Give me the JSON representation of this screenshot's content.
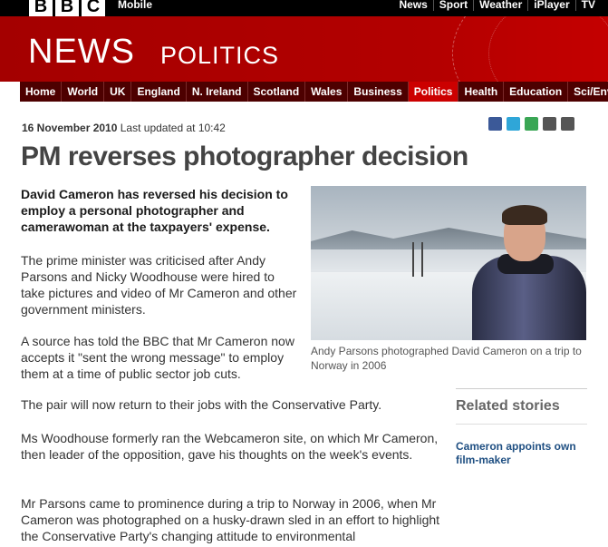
{
  "topbar": {
    "logo_letters": [
      "B",
      "B",
      "C"
    ],
    "mobile": "Mobile",
    "links": [
      "News",
      "Sport",
      "Weather",
      "iPlayer",
      "TV"
    ]
  },
  "banner": {
    "news": "NEWS",
    "section": "POLITICS"
  },
  "nav": {
    "items": [
      "Home",
      "World",
      "UK",
      "England",
      "N. Ireland",
      "Scotland",
      "Wales",
      "Business",
      "Politics",
      "Health",
      "Education",
      "Sci/Environment"
    ],
    "active": "Politics"
  },
  "article": {
    "date": "16 November 2010",
    "updated": "Last updated at 10:42",
    "headline": "PM reverses photographer decision",
    "intro": "David Cameron has reversed his decision to employ a personal photographer and camerawoman at the taxpayers' expense.",
    "paragraphs": [
      "The prime minister was criticised after Andy Parsons and Nicky Woodhouse were hired to take pictures and video of Mr Cameron and other government ministers.",
      "A source has told the BBC that Mr Cameron now accepts it \"sent the wrong message\" to employ them at a time of public sector job cuts.",
      "The pair will now return to their jobs with the Conservative Party.",
      "Ms Woodhouse formerly ran the Webcameron site, on which Mr Cameron, then leader of the opposition, gave his thoughts on the week's events.",
      "Mr Parsons came to prominence during a trip to Norway in 2006, when Mr Cameron was photographed on a husky-drawn sled in an effort to highlight the Conservative Party's changing attitude to environmental"
    ],
    "caption": "Andy Parsons photographed David Cameron on a trip to Norway in 2006"
  },
  "share_icons": [
    {
      "name": "facebook-icon",
      "color": "#3b5998"
    },
    {
      "name": "twitter-icon",
      "color": "#2fa6d8"
    },
    {
      "name": "share-icon",
      "color": "#3aa655"
    },
    {
      "name": "email-icon",
      "color": "#555555"
    },
    {
      "name": "print-icon",
      "color": "#555555"
    }
  ],
  "related": {
    "heading": "Related stories",
    "links": [
      "Cameron appoints own film-maker"
    ]
  }
}
